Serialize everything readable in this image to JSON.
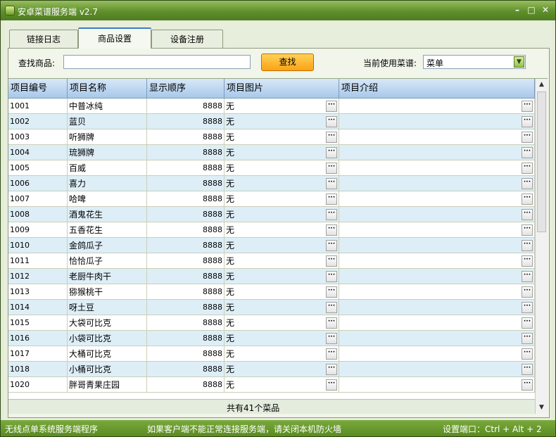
{
  "window": {
    "title": "安卓菜谱服务端 v2.7",
    "minimize": "–",
    "maximize": "□",
    "close": "✕"
  },
  "tabs": [
    {
      "label": "链接日志",
      "active": false
    },
    {
      "label": "商品设置",
      "active": true
    },
    {
      "label": "设备注册",
      "active": false
    }
  ],
  "search": {
    "label": "查找商品:",
    "value": "",
    "button": "查找"
  },
  "menu_select": {
    "label": "当前使用菜谱:",
    "value": "菜单"
  },
  "table": {
    "columns": [
      "项目编号",
      "项目名称",
      "显示顺序",
      "项目图片",
      "项目介绍"
    ],
    "rows": [
      {
        "id": "1001",
        "name": "中普冰纯",
        "order": "8888",
        "image": "无"
      },
      {
        "id": "1002",
        "name": "蓝贝",
        "order": "8888",
        "image": "无"
      },
      {
        "id": "1003",
        "name": "听狮牌",
        "order": "8888",
        "image": "无"
      },
      {
        "id": "1004",
        "name": "琉狮牌",
        "order": "8888",
        "image": "无"
      },
      {
        "id": "1005",
        "name": "百威",
        "order": "8888",
        "image": "无"
      },
      {
        "id": "1006",
        "name": "喜力",
        "order": "8888",
        "image": "无"
      },
      {
        "id": "1007",
        "name": "哈啤",
        "order": "8888",
        "image": "无"
      },
      {
        "id": "1008",
        "name": "酒鬼花生",
        "order": "8888",
        "image": "无"
      },
      {
        "id": "1009",
        "name": "五香花生",
        "order": "8888",
        "image": "无"
      },
      {
        "id": "1010",
        "name": "金鸽瓜子",
        "order": "8888",
        "image": "无"
      },
      {
        "id": "1011",
        "name": "恰恰瓜子",
        "order": "8888",
        "image": "无"
      },
      {
        "id": "1012",
        "name": "老厨牛肉干",
        "order": "8888",
        "image": "无"
      },
      {
        "id": "1013",
        "name": "猕猴桃干",
        "order": "8888",
        "image": "无"
      },
      {
        "id": "1014",
        "name": "呀土豆",
        "order": "8888",
        "image": "无"
      },
      {
        "id": "1015",
        "name": "大袋可比克",
        "order": "8888",
        "image": "无"
      },
      {
        "id": "1016",
        "name": "小袋可比克",
        "order": "8888",
        "image": "无"
      },
      {
        "id": "1017",
        "name": "大桶可比克",
        "order": "8888",
        "image": "无"
      },
      {
        "id": "1018",
        "name": "小桶可比克",
        "order": "8888",
        "image": "无"
      },
      {
        "id": "1020",
        "name": "胖哥青果庄园",
        "order": "8888",
        "image": "无"
      }
    ],
    "ellipsis": "···",
    "summary": "共有41个菜品"
  },
  "statusbar": {
    "left": "无线点单系统服务端程序",
    "center": "如果客户端不能正常连接服务端，请关闭本机防火墙",
    "right": "设置端口：Ctrl + Alt + 2"
  },
  "colors": {
    "title_green": "#5f8f2b",
    "header_blue": "#a7c8ea",
    "row_alt": "#ddeef7",
    "search_orange": "#fba213"
  }
}
